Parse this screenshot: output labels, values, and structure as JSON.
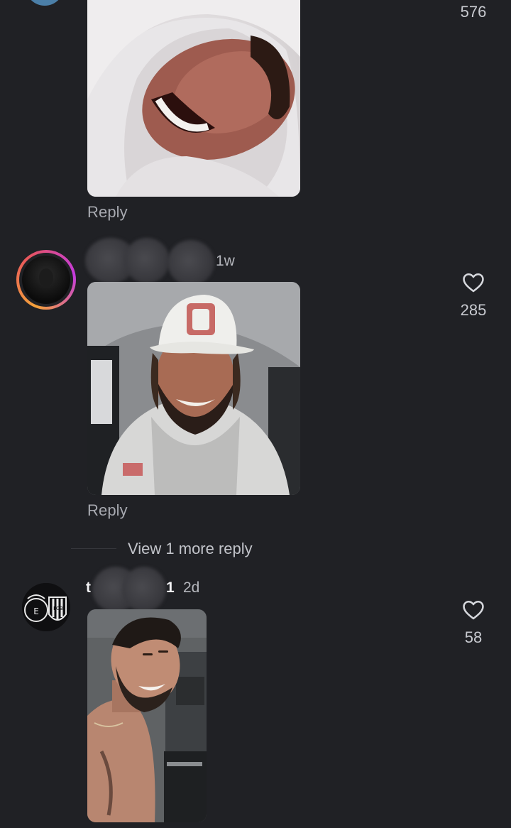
{
  "comments": [
    {
      "likes": "576",
      "reply_label": "Reply"
    },
    {
      "time": "1w",
      "likes": "285",
      "reply_label": "Reply",
      "view_more": "View 1 more reply"
    },
    {
      "username_start": "t",
      "username_end": "1",
      "time": "2d",
      "likes": "58",
      "avatar_badges": [
        "E",
        "FCB"
      ]
    }
  ],
  "icons": {
    "like": "heart-outline-icon"
  },
  "colors": {
    "background": "#202125",
    "secondary_text": "#a7a9b0",
    "story_ring_start": "#f4a23a",
    "story_ring_end": "#c43adf"
  }
}
